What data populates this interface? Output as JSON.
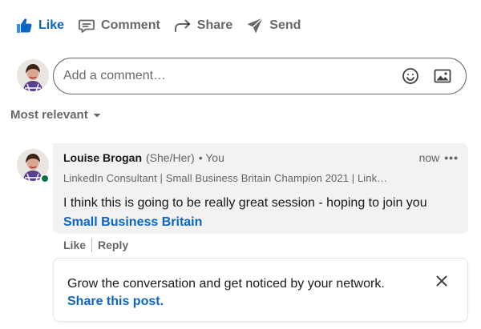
{
  "actions": {
    "like": "Like",
    "comment": "Comment",
    "share": "Share",
    "send": "Send"
  },
  "composer": {
    "placeholder": "Add a comment…",
    "emoji_icon": "smiley-icon",
    "image_icon": "image-icon"
  },
  "sort": {
    "label": "Most relevant",
    "icon": "caret-down-icon"
  },
  "comment": {
    "author": "Louise Brogan",
    "pronouns": "(She/Her)",
    "tag": "• You",
    "time": "now",
    "more": "•••",
    "headline": "LinkedIn Consultant | Small Business Britain Champion 2021 | Link…",
    "text": "I think this is going to be really great session - hoping to join you",
    "mention": "Small Business Britain",
    "like_label": "Like",
    "reply_label": "Reply"
  },
  "prompt": {
    "text": "Grow the conversation and get noticed by your network.",
    "link": "Share this post.",
    "close_icon": "close-icon"
  },
  "colors": {
    "accent": "#0a66c2",
    "presence": "#057642",
    "bubble": "#f2f2f2"
  }
}
